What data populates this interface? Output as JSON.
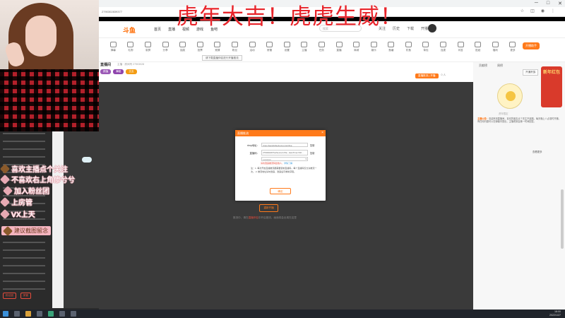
{
  "overlay_title": "虎年大吉！虎虎生威！",
  "browser": {
    "url_text": "2790302839377"
  },
  "site": {
    "logo": "斗鱼",
    "nav": [
      "首页",
      "直播",
      "视频",
      "游戏",
      "鱼吧"
    ],
    "search_placeholder": "搜索",
    "nav_actions": [
      "关注",
      "历史",
      "下载",
      "开播"
    ]
  },
  "toolbar": {
    "tools": [
      "弹幕",
      "礼物",
      "录屏",
      "分享",
      "抽奖",
      "投票",
      "竞猜",
      "粉丝",
      "活动",
      "房管",
      "设置",
      "主播",
      "任务",
      "直播",
      "商城",
      "娱乐",
      "鱼塘",
      "钓鱼",
      "背包",
      "连麦",
      "问答",
      "贴纸",
      "福利",
      "更多"
    ],
    "tip": "请下载直播伴侣进行开播推流",
    "right_button": "开播助手"
  },
  "room": {
    "name": "直播间",
    "meta": "主播 · 房间号 27903028",
    "tags": [
      "颜值",
      "舞蹈",
      "交友"
    ],
    "right_btn": "直播推流 | 开播",
    "right_text": "0 人"
  },
  "modal": {
    "title": "直播推流",
    "rtmp_label": "rtmp地址：",
    "rtmp_value": "rtmp://sendtc3a.douyu.com/live",
    "code_label": "直播码：",
    "code_value": "2790302R?wsSecret=c5a...&wsTime=61f...",
    "copy": "复制",
    "select_value": "1000000",
    "warn_text": "请勿泄露推流码给他人，",
    "warn_link": "详情了解",
    "tips": "注：1. 每次开启直播推流都需要复制直播码，每个直播码仅允许推流一次。 2. 推流地址请勿泄露，泄露后可重新获取。",
    "confirm": "确定"
  },
  "player": {
    "button": "重新开播",
    "hint_prefix": "推流中，请在",
    "hint_link": "直播伴侣",
    "hint_suffix": "中开启推流，画面将会出现在这里"
  },
  "right_panel": {
    "tabs": [
      "贡献榜",
      "周榜"
    ],
    "btn": "开通贵族",
    "hongbao": "新年红包",
    "caption": "虎年限定",
    "text_head": "主播公告：",
    "text": "欢迎来到直播间，喜欢的朋友点个关注不迷路，每天晚上八点准时开播，有任何问题可以在弹幕中提出，主播看到会第一时间回复。",
    "bottom": "查看更多"
  },
  "chat": [
    {
      "text": "喜欢主播点个关注",
      "icon": "strawberry-icon",
      "boxed": false
    },
    {
      "text": "不喜欢右上角惨兮兮",
      "icon": "heart-icon",
      "boxed": false
    },
    {
      "text": "加入粉丝团",
      "icon": "badge-icon",
      "boxed": false
    },
    {
      "text": "上房管",
      "icon": "heart-icon",
      "boxed": false
    },
    {
      "text": "VX上天",
      "icon": "heart-icon",
      "boxed": false
    },
    {
      "text": "建议截图留念",
      "icon": "strawberry-icon",
      "boxed": true
    }
  ],
  "sidebar": {
    "buttons": [
      "粉丝团",
      "房管"
    ]
  },
  "taskbar": {
    "time": "18:00",
    "date": "2022/1/27"
  },
  "colors": {
    "accent": "#ff7a1a",
    "title": "#e8242a"
  }
}
